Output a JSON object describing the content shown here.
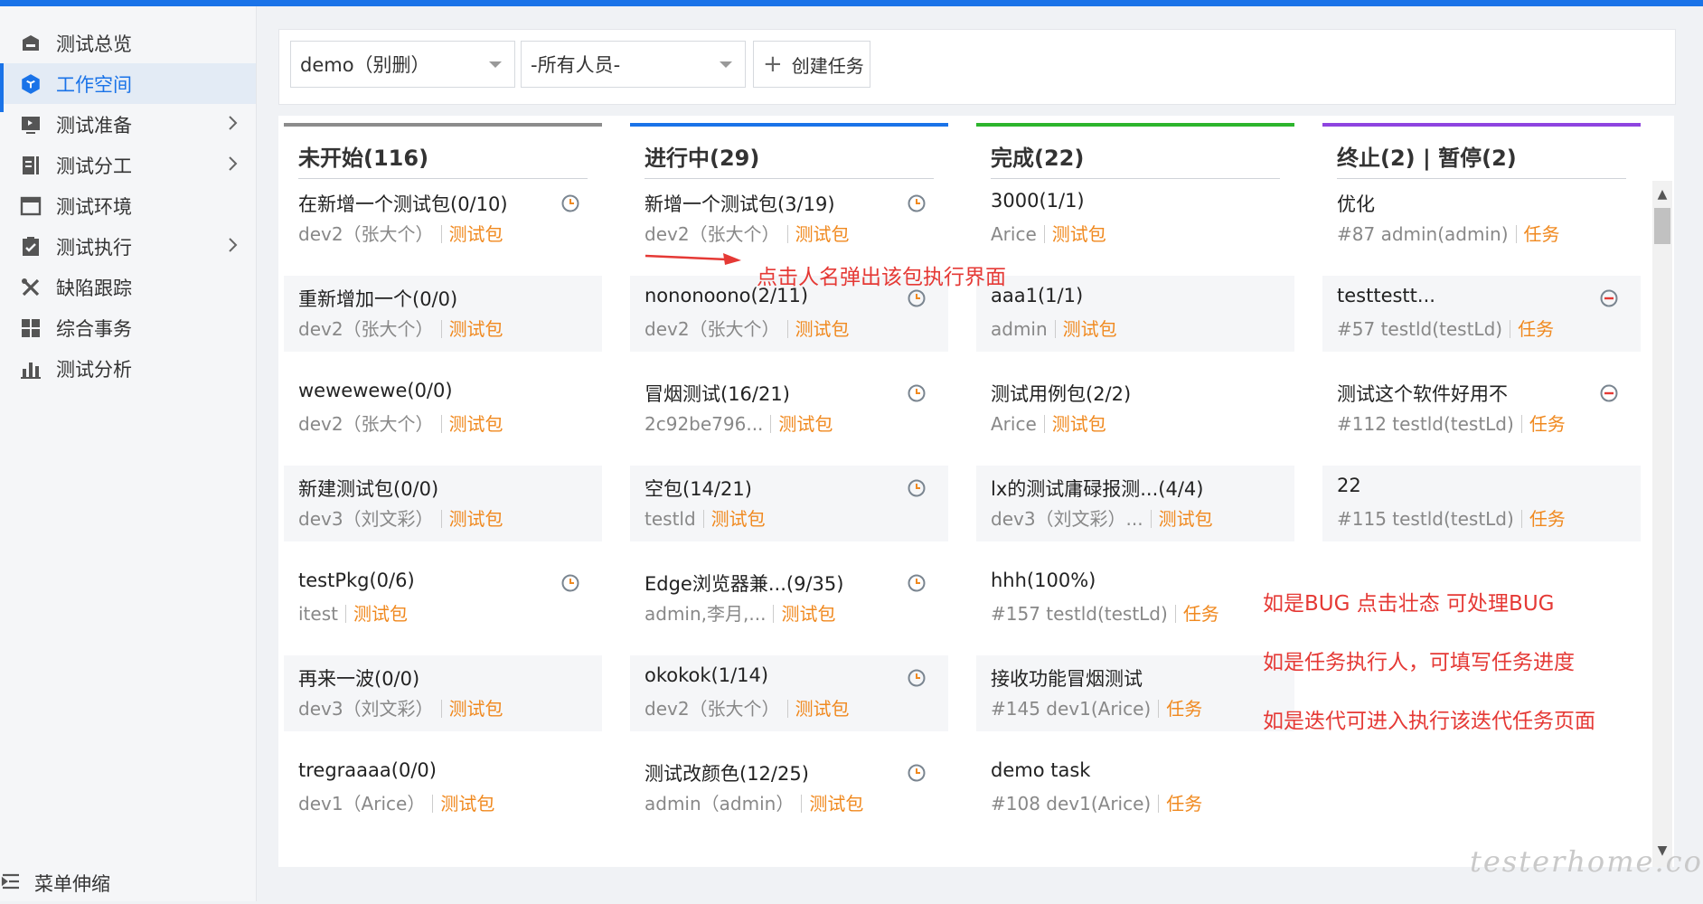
{
  "sidebar": {
    "items": [
      {
        "label": "测试总览",
        "icon": "home-icon",
        "has_arrow": false,
        "active": false
      },
      {
        "label": "工作空间",
        "icon": "cube-icon",
        "has_arrow": false,
        "active": true
      },
      {
        "label": "测试准备",
        "icon": "monitor-icon",
        "has_arrow": true,
        "active": false
      },
      {
        "label": "测试分工",
        "icon": "split-icon",
        "has_arrow": true,
        "active": false
      },
      {
        "label": "测试环境",
        "icon": "window-icon",
        "has_arrow": false,
        "active": false
      },
      {
        "label": "测试执行",
        "icon": "checklist-icon",
        "has_arrow": true,
        "active": false
      },
      {
        "label": "缺陷跟踪",
        "icon": "tools-icon",
        "has_arrow": false,
        "active": false
      },
      {
        "label": "综合事务",
        "icon": "grid-icon",
        "has_arrow": false,
        "active": false
      },
      {
        "label": "测试分析",
        "icon": "bar-chart-icon",
        "has_arrow": false,
        "active": false
      }
    ],
    "collapse_label": "菜单伸缩"
  },
  "toolbar": {
    "project_select": "demo（别删）",
    "member_select": "-所有人员-",
    "create_label": "创建任务"
  },
  "columns": [
    {
      "title": "未开始(116)",
      "color": "#8c8c8c",
      "cards": [
        {
          "title": "在新增一个测试包(0/10)",
          "owner": "dev2（张大个）",
          "tag": "测试包",
          "icon": "clock"
        },
        {
          "title": "重新增加一个(0/0)",
          "owner": "dev2（张大个）",
          "tag": "测试包",
          "icon": ""
        },
        {
          "title": "wewewewe(0/0)",
          "owner": "dev2（张大个）",
          "tag": "测试包",
          "icon": ""
        },
        {
          "title": "新建测试包(0/0)",
          "owner": "dev3（刘文彩）",
          "tag": "测试包",
          "icon": ""
        },
        {
          "title": "testPkg(0/6)",
          "owner": "itest",
          "tag": "测试包",
          "icon": "clock"
        },
        {
          "title": "再来一波(0/0)",
          "owner": "dev3（刘文彩）",
          "tag": "测试包",
          "icon": ""
        },
        {
          "title": "tregraaaa(0/0)",
          "owner": "dev1（Arice）",
          "tag": "测试包",
          "icon": ""
        }
      ]
    },
    {
      "title": "进行中(29)",
      "color": "#1a73e8",
      "cards": [
        {
          "title": "新增一个测试包(3/19)",
          "owner": "dev2（张大个）",
          "tag": "测试包",
          "icon": "clock"
        },
        {
          "title": "nononoono(2/11)",
          "owner": "dev2（张大个）",
          "tag": "测试包",
          "icon": "clock"
        },
        {
          "title": "冒烟测试(16/21)",
          "owner": "2c92be796...",
          "tag": "测试包",
          "icon": "clock"
        },
        {
          "title": "空包(14/21)",
          "owner": "testld",
          "tag": "测试包",
          "icon": "clock"
        },
        {
          "title": "Edge浏览器兼...(9/35)",
          "owner": "admin,李月,...",
          "tag": "测试包",
          "icon": "clock"
        },
        {
          "title": "okokok(1/14)",
          "owner": "dev2（张大个）",
          "tag": "测试包",
          "icon": "clock"
        },
        {
          "title": "测试改颜色(12/25)",
          "owner": "admin（admin）",
          "tag": "测试包",
          "icon": "clock"
        }
      ]
    },
    {
      "title": "完成(22)",
      "color": "#2db52d",
      "cards": [
        {
          "title": "3000(1/1)",
          "owner": "Arice",
          "tag": "测试包",
          "icon": ""
        },
        {
          "title": "aaa1(1/1)",
          "owner": "admin",
          "tag": "测试包",
          "icon": ""
        },
        {
          "title": "测试用例包(2/2)",
          "owner": "Arice",
          "tag": "测试包",
          "icon": ""
        },
        {
          "title": "lx的测试庸碌报测...(4/4)",
          "owner": "dev3（刘文彩）...",
          "tag": "测试包",
          "icon": ""
        },
        {
          "title": "hhh(100%)",
          "owner": "#157 testld(testLd)",
          "tag": "任务",
          "icon": ""
        },
        {
          "title": "接收功能冒烟测试",
          "owner": "#145 dev1(Arice)",
          "tag": "任务",
          "icon": ""
        },
        {
          "title": "demo task",
          "owner": "#108 dev1(Arice)",
          "tag": "任务",
          "icon": ""
        }
      ]
    },
    {
      "title": "终止(2)  |  暂停(2)",
      "color": "#8e44e0",
      "cards": [
        {
          "title": "优化",
          "owner": "#87 admin(admin)",
          "tag": "任务",
          "icon": ""
        },
        {
          "title": "testtestt...",
          "owner": "#57 testld(testLd)",
          "tag": "任务",
          "icon": "stop"
        },
        {
          "title": "测试这个软件好用不",
          "owner": "#112 testld(testLd)",
          "tag": "任务",
          "icon": "stop"
        },
        {
          "title": "22",
          "owner": "#115 testld(testLd)",
          "tag": "任务",
          "icon": ""
        }
      ]
    }
  ],
  "annotations": {
    "click_name": "点击人名弹出该包执行界面",
    "bug_note": "如是BUG 点击壮态 可处理BUG",
    "task_note": "如是任务执行人，可填写任务进度",
    "iter_note": "如是迭代可进入执行该迭代任务页面"
  },
  "watermark": "testerhome.com",
  "colors": {
    "accent": "#1a73e8",
    "tag": "#f0891f",
    "annotation": "#e53935"
  }
}
